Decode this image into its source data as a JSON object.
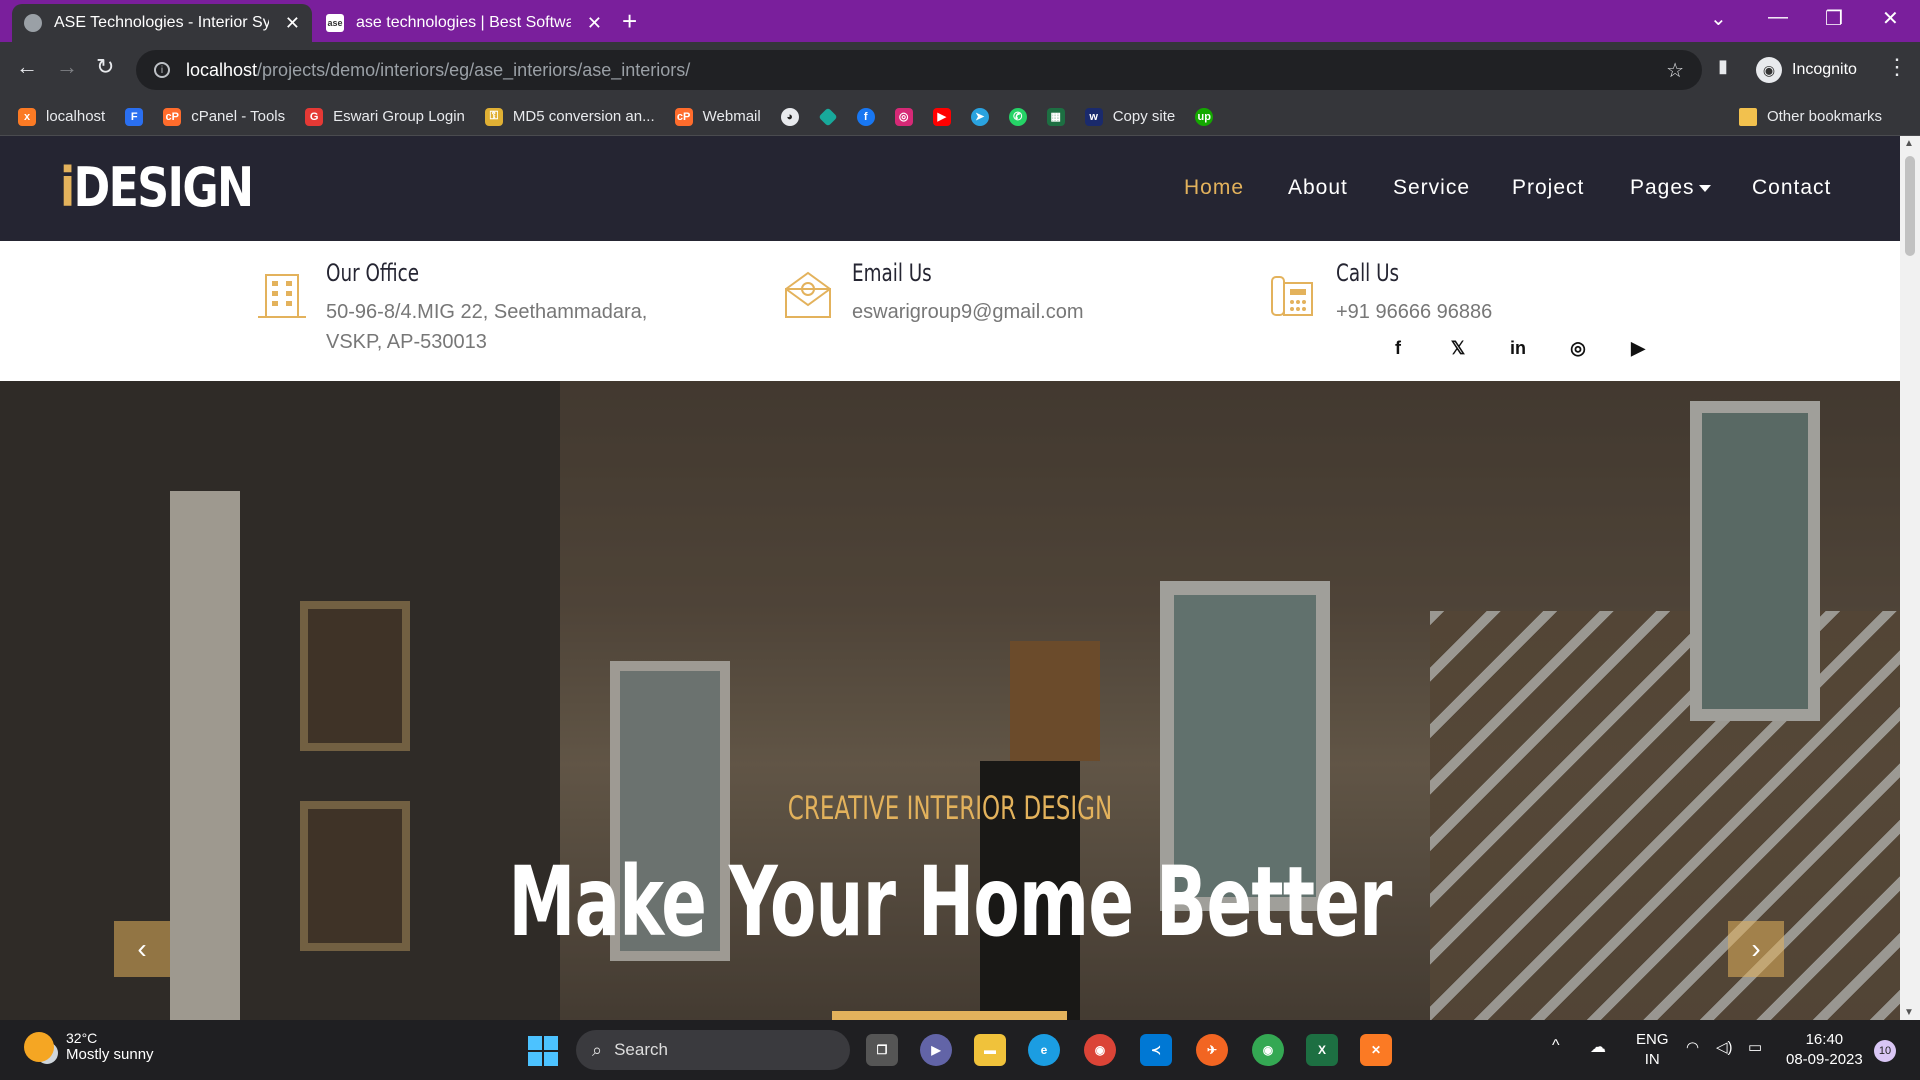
{
  "browser": {
    "tabs": [
      {
        "title": "ASE Technologies - Interior Syste",
        "active": true
      },
      {
        "title": "ase technologies | Best Software",
        "active": false
      }
    ],
    "new_tab_icon": "+",
    "address": {
      "host": "localhost",
      "path": "/projects/demo/interiors/eg/ase_interiors/ase_interiors/"
    },
    "profile_label": "Incognito",
    "bookmarks": [
      {
        "label": "localhost",
        "icon": "xampp-icon",
        "color": "#fb7a24"
      },
      {
        "label": "",
        "icon": "f-icon",
        "color": "#2a6ff0"
      },
      {
        "label": "cPanel - Tools",
        "icon": "cpanel-icon",
        "color": "#ff6c2c"
      },
      {
        "label": "Eswari Group Login",
        "icon": "e-icon",
        "color": "#e53935"
      },
      {
        "label": "MD5 conversion an...",
        "icon": "key-icon",
        "color": "#e0b034"
      },
      {
        "label": "Webmail",
        "icon": "cpanel-icon",
        "color": "#ff6c2c"
      },
      {
        "label": "",
        "icon": "github-icon",
        "color": "#e8eaed"
      },
      {
        "label": "",
        "icon": "diamond-icon",
        "color": "#18a99b"
      },
      {
        "label": "",
        "icon": "facebook-icon",
        "color": "#1877f2"
      },
      {
        "label": "",
        "icon": "instagram-icon",
        "color": "#d62976"
      },
      {
        "label": "",
        "icon": "youtube-icon",
        "color": "#ff0000"
      },
      {
        "label": "",
        "icon": "telegram-icon",
        "color": "#2aa3e0"
      },
      {
        "label": "",
        "icon": "whatsapp-icon",
        "color": "#25d366"
      },
      {
        "label": "",
        "icon": "excel-icon",
        "color": "#1d6f42"
      },
      {
        "label": "Copy site",
        "icon": "w-icon",
        "color": "#1a2a6c"
      },
      {
        "label": "",
        "icon": "upwork-icon",
        "color": "#14a800"
      }
    ],
    "other_bookmarks": "Other bookmarks"
  },
  "site": {
    "logo_i": "i",
    "logo_rest": "DESIGN",
    "nav": [
      "Home",
      "About",
      "Service",
      "Project",
      "Pages",
      "Contact"
    ],
    "accent": "#e3b25c",
    "contact": {
      "office": {
        "title": "Our Office",
        "line1": "50-96-8/4.MIG 22, Seethammadara,",
        "line2": "VSKP, AP-530013"
      },
      "email": {
        "title": "Email Us",
        "value": "eswarigroup9@gmail.com"
      },
      "call": {
        "title": "Call Us",
        "value": "+91 96666 96886"
      }
    },
    "social": [
      "f",
      "𝕏",
      "in",
      "◎",
      "▶"
    ],
    "hero": {
      "subtitle": "CREATIVE INTERIOR DESIGN",
      "headline": "Make Your Home Better"
    }
  },
  "taskbar": {
    "weather_temp": "32°C",
    "weather_desc": "Mostly sunny",
    "search_label": "Search",
    "lang_1": "ENG",
    "lang_2": "IN",
    "time": "16:40",
    "date": "08-09-2023",
    "notifications": "10"
  }
}
